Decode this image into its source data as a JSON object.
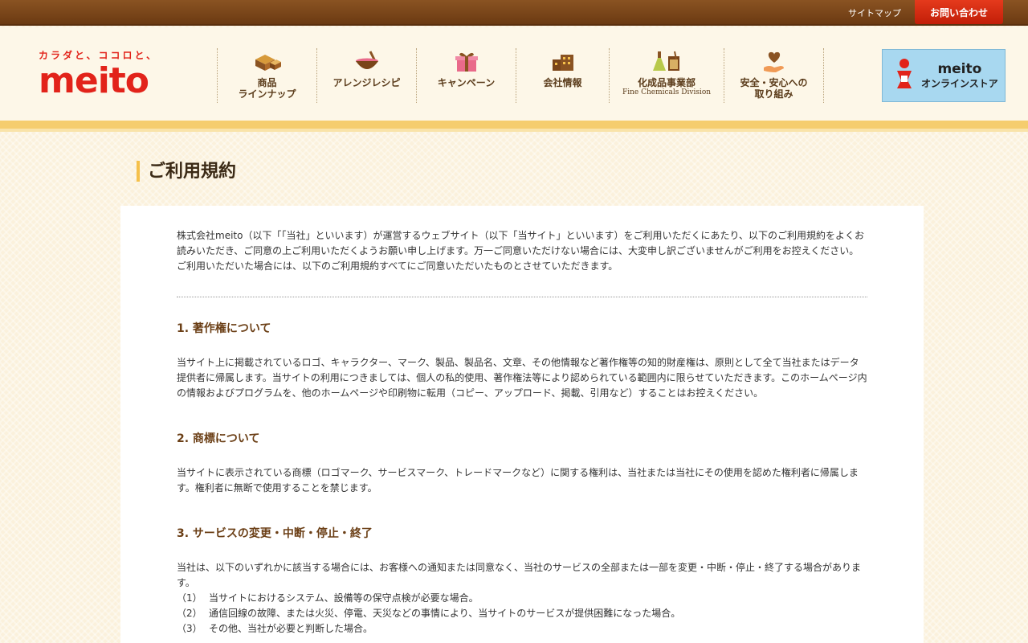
{
  "topbar": {
    "sitemap": "サイトマップ",
    "contact": "お問い合わせ"
  },
  "logo": {
    "tagline": "カラダと、ココロと、",
    "word": "meito"
  },
  "nav": [
    {
      "label": "商品\nラインナップ",
      "icon": "sweets-box-icon",
      "sub": ""
    },
    {
      "label": "アレンジレシピ",
      "icon": "mixing-bowl-icon",
      "sub": ""
    },
    {
      "label": "キャンペーン",
      "icon": "gift-icon",
      "sub": ""
    },
    {
      "label": "会社情報",
      "icon": "building-icon",
      "sub": ""
    },
    {
      "label": "化成品事業部",
      "icon": "flask-icon",
      "sub": "Fine Chemicals Division"
    },
    {
      "label": "安全・安心への\n取り組み",
      "icon": "heart-hand-icon",
      "sub": ""
    }
  ],
  "store": {
    "brand": "meito",
    "label": "オンラインストア"
  },
  "page_title": "ご利用規約",
  "intro": "株式会社meito（以下「「当社」といいます）が運営するウェブサイト（以下「当サイト」といいます）をご利用いただくにあたり、以下のご利用規約をよくお読みいただき、ご同意の上ご利用いただくようお願い申し上げます。万一ご同意いただけない場合には、大変申し訳ございませんがご利用をお控えください。ご利用いただいた場合には、以下のご利用規約すべてにご同意いただいたものとさせていただきます。",
  "sections": [
    {
      "heading": "1.  著作権について",
      "body": "当サイト上に掲載されているロゴ、キャラクター、マーク、製品、製品名、文章、その他情報など著作権等の知的財産権は、原則として全て当社またはデータ提供者に帰属します。当サイトの利用につきましては、個人の私的使用、著作権法等により認められている範囲内に限らせていただきます。このホームページ内の情報およびプログラムを、他のホームページや印刷物に転用（コピー、アップロード、掲載、引用など）することはお控えください。"
    },
    {
      "heading": "2.  商標について",
      "body": "当サイトに表示されている商標（ロゴマーク、サービスマーク、トレードマークなど）に関する権利は、当社または当社にその使用を認めた権利者に帰属します。権利者に無断で使用することを禁じます。"
    },
    {
      "heading": "3.  サービスの変更・中断・停止・終了",
      "body": "当社は、以下のいずれかに該当する場合には、お客様への通知または同意なく、当社のサービスの全部または一部を変更・中断・停止・終了する場合があります。",
      "items": [
        {
          "num": "（1）",
          "text": "当サイトにおけるシステム、設備等の保守点検が必要な場合。"
        },
        {
          "num": "（2）",
          "text": "通信回線の故障、または火災、停電、天災などの事情により、当サイトのサービスが提供困難になった場合。"
        },
        {
          "num": "（3）",
          "text": "その他、当社が必要と判断した場合。"
        }
      ]
    }
  ],
  "colors": {
    "brand_red": "#e2231a",
    "header_brown": "#6b3a12",
    "accent_yellow": "#f5c04a",
    "heading_brown": "#6b3f16"
  }
}
